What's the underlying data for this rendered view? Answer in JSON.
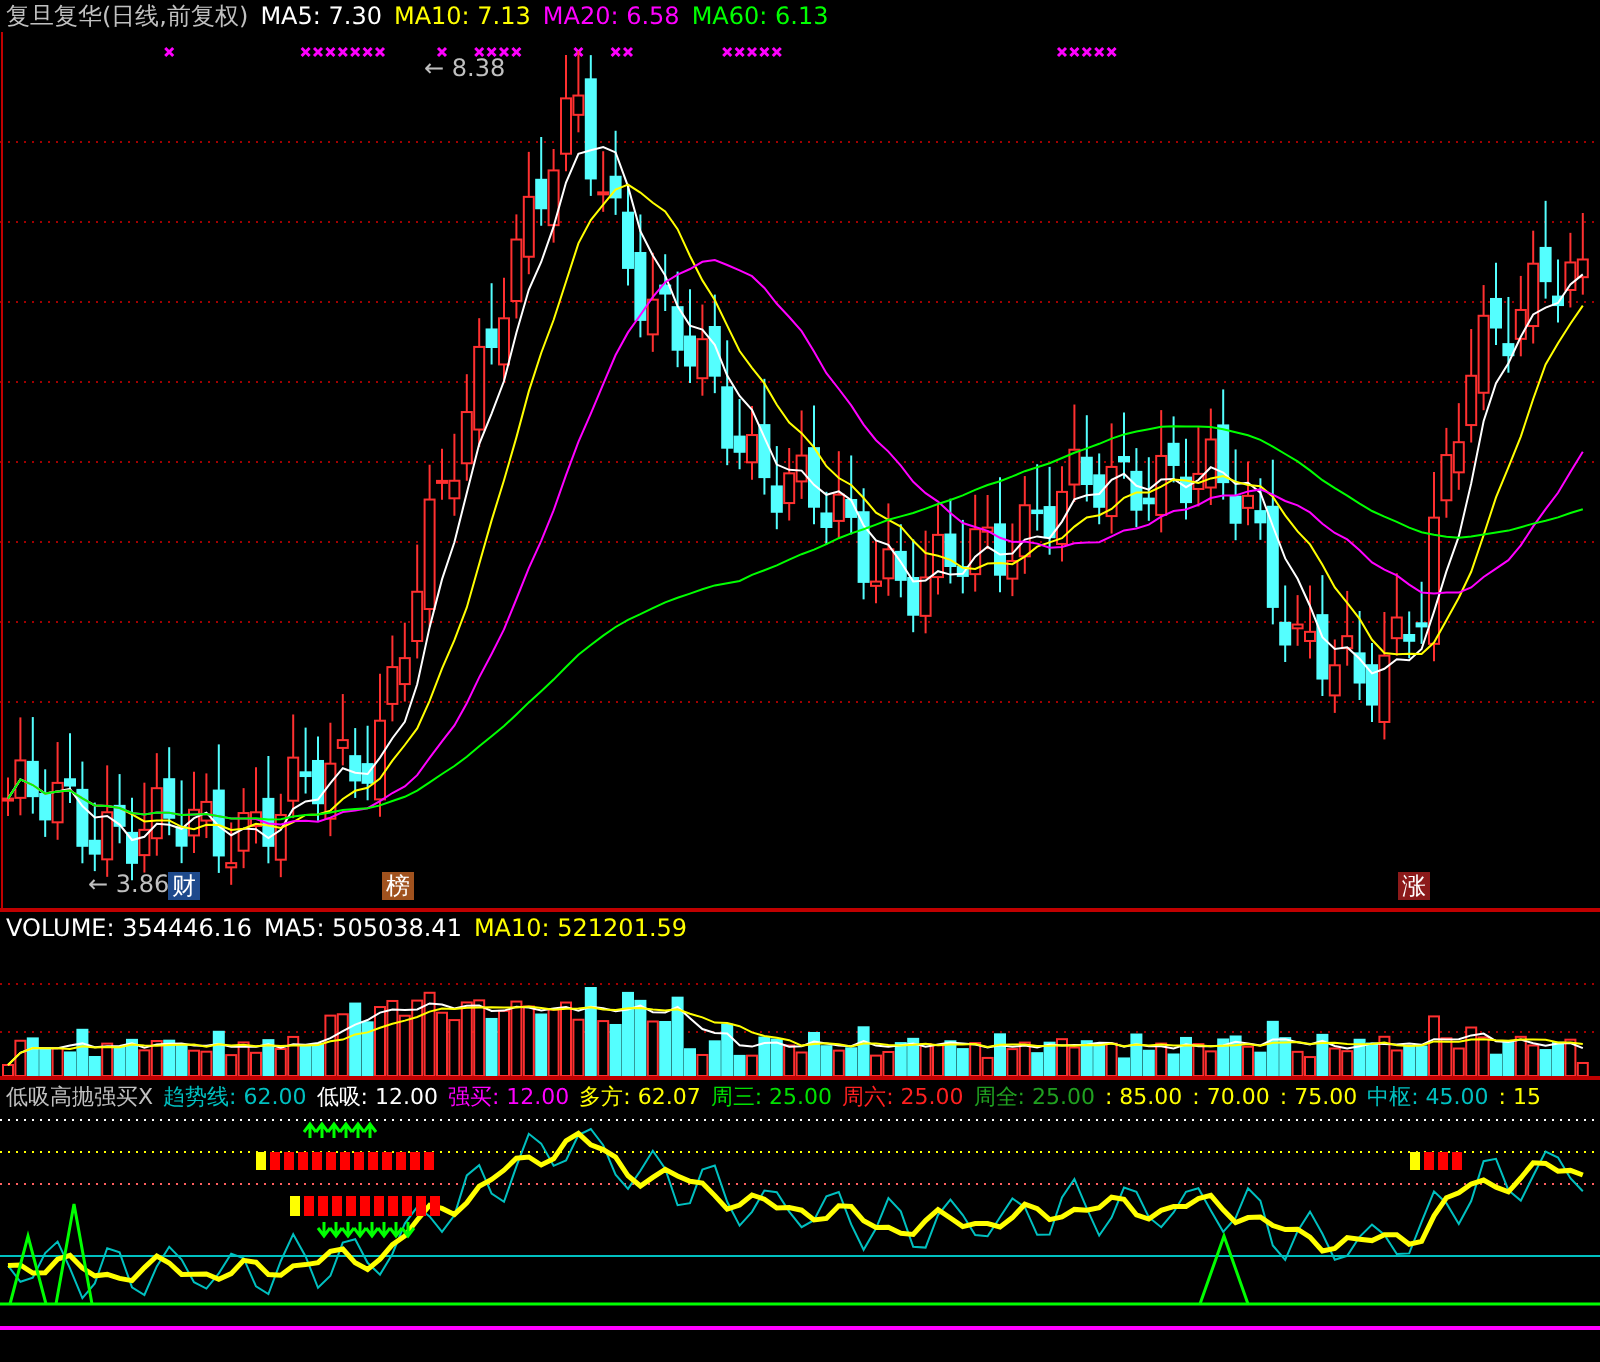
{
  "main_legend": [
    {
      "label": "复旦复华(日线,前复权)",
      "color": "#c0c0c0"
    },
    {
      "label": "MA5: 7.30",
      "color": "#ffffff"
    },
    {
      "label": "MA10: 7.13",
      "color": "#ffff00"
    },
    {
      "label": "MA20: 6.58",
      "color": "#ff00ff"
    },
    {
      "label": "MA60: 6.13",
      "color": "#00ff00"
    }
  ],
  "price_marks": [
    {
      "label": "← 8.38",
      "kind": "high"
    },
    {
      "label": "← 3.86",
      "kind": "low"
    }
  ],
  "event_badges": [
    {
      "label": "财",
      "color": "#1e4a8c"
    },
    {
      "label": "榜",
      "color": "#a0521e"
    },
    {
      "label": "涨",
      "color": "#8c1a1a"
    }
  ],
  "volume_legend": [
    {
      "label": "VOLUME: 354446.16",
      "color": "#ffffff"
    },
    {
      "label": "MA5: 505038.41",
      "color": "#ffffff"
    },
    {
      "label": "MA10: 521201.59",
      "color": "#ffff00"
    }
  ],
  "indicator_legend": [
    {
      "label": "低吸高抛强买X",
      "color": "#c0c0c0"
    },
    {
      "label": "趋势线: 62.00",
      "color": "#00c0c0"
    },
    {
      "label": "低吸: 12.00",
      "color": "#ffffff"
    },
    {
      "label": "强买: 12.00",
      "color": "#ff00ff"
    },
    {
      "label": "多方: 62.07",
      "color": "#ffff00"
    },
    {
      "label": "周三: 25.00",
      "color": "#00e000"
    },
    {
      "label": "周六: 25.00",
      "color": "#ff2020"
    },
    {
      "label": "周全: 25.00",
      "color": "#20a020"
    },
    {
      "label": ": 85.00",
      "color": "#ffff00"
    },
    {
      "label": ": 70.00",
      "color": "#ffff00"
    },
    {
      "label": ": 75.00",
      "color": "#ffff00"
    },
    {
      "label": "中枢: 45.00",
      "color": "#00c0c0"
    },
    {
      "label": ": 15",
      "color": "#ffff00"
    }
  ]
}
